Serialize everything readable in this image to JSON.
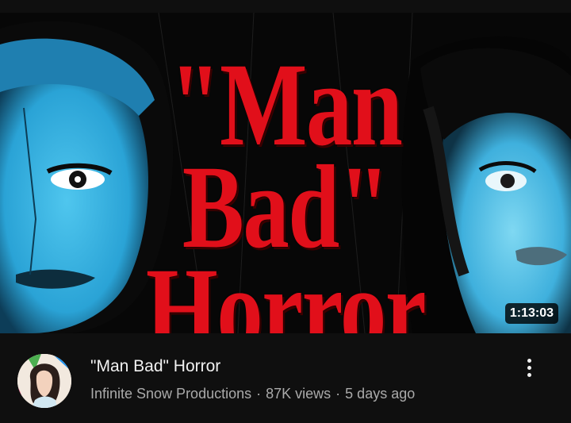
{
  "video": {
    "thumbnail_title_line1": "\"Man Bad\"",
    "thumbnail_title_line2": "Horror",
    "duration": "1:13:03",
    "title": "\"Man Bad\" Horror",
    "channel": "Infinite Snow Productions",
    "views": "87K views",
    "age": "5 days ago",
    "separator": "·"
  },
  "icons": {
    "more": "more-vertical-icon",
    "avatar": "channel-avatar"
  },
  "colors": {
    "background": "#0f0f0f",
    "title_art_red": "#e10f1a",
    "face_cyan": "#36b7e6",
    "subtext": "#aaaaaa"
  }
}
